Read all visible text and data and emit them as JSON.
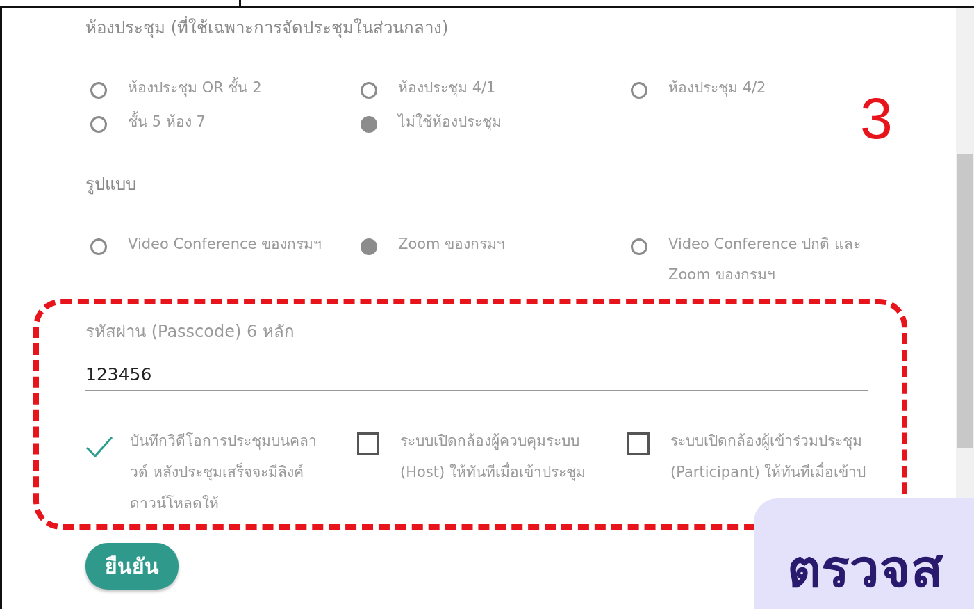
{
  "sections": [
    {
      "title": "ห้องประชุม (ที่ใช้เฉพาะการจัดประชุมในส่วนกลาง)",
      "options": [
        {
          "label": "ห้องประชุม OR ชั้น 2",
          "selected": false
        },
        {
          "label": "ห้องประชุม 4/1",
          "selected": false
        },
        {
          "label": "ห้องประชุม 4/2",
          "selected": false
        },
        {
          "label": "ชั้น 5 ห้อง 7",
          "selected": false
        },
        {
          "label": "ไม่ใช้ห้องประชุม",
          "selected": true
        }
      ]
    },
    {
      "title": "รูปแบบ",
      "options": [
        {
          "label": "Video Conference ของกรมฯ",
          "selected": false
        },
        {
          "label": "Zoom ของกรมฯ",
          "selected": true
        },
        {
          "label": "Video Conference ปกติ และ Zoom ของกรมฯ",
          "selected": false
        }
      ]
    }
  ],
  "passcode": {
    "label": "รหัสผ่าน (Passcode) 6 หลัก",
    "value": "123456"
  },
  "checkboxes": [
    {
      "label": "บันทึกวิดีโอการประชุมบนคลาวด์ หลังประชุมเสร็จจะมีลิงค์ดาวน์โหลดให้",
      "checked": true
    },
    {
      "label": "ระบบเปิดกล้องผู้ควบคุมระบบ (Host) ให้ทันทีเมื่อเข้าประชุม",
      "checked": false
    },
    {
      "label": "ระบบเปิดกล้องผู้เข้าร่วมประชุม (Participant) ให้ทันทีเมื่อเข้าป",
      "checked": false
    }
  ],
  "submit": "ยืนยัน",
  "step_number": "3",
  "overlay_text": "ตรวจส"
}
